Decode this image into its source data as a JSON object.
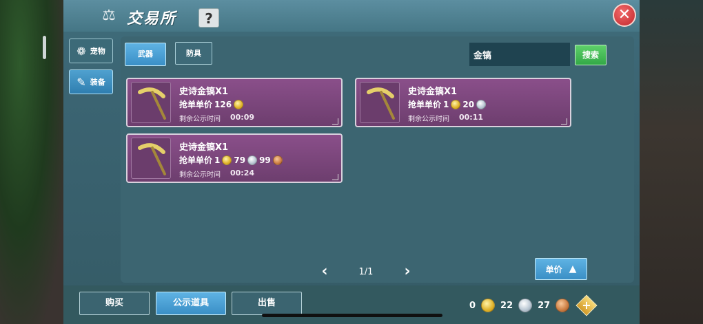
{
  "window": {
    "title": "交易所",
    "help_label": "?",
    "close_label": "✕"
  },
  "sidebar": {
    "items": [
      {
        "label": "宠物",
        "icon": "paw-icon"
      },
      {
        "label": "装备",
        "icon": "equip-icon"
      }
    ]
  },
  "tabs": [
    {
      "label": "武器",
      "active": true
    },
    {
      "label": "防具",
      "active": false
    }
  ],
  "search": {
    "value": "金镐",
    "button_label": "搜索"
  },
  "listings": [
    {
      "name": "史诗金镐X1",
      "price_label": "抢单单价",
      "price": [
        {
          "amount": "126",
          "coin": "gold"
        }
      ],
      "time_label": "剩余公示时间",
      "time": "00:09"
    },
    {
      "name": "史诗金镐X1",
      "price_label": "抢单单价",
      "price": [
        {
          "amount": "1",
          "coin": "gold"
        },
        {
          "amount": "20",
          "coin": "silver"
        }
      ],
      "time_label": "剩余公示时间",
      "time": "00:11"
    },
    {
      "name": "史诗金镐X1",
      "price_label": "抢单单价",
      "price": [
        {
          "amount": "1",
          "coin": "gold"
        },
        {
          "amount": "79",
          "coin": "silver"
        },
        {
          "amount": "99",
          "coin": "copper"
        }
      ],
      "time_label": "剩余公示时间",
      "time": "00:24"
    }
  ],
  "pagination": {
    "prev": "‹",
    "next": "›",
    "page": "1/1"
  },
  "sort": {
    "label": "单价",
    "direction_icon": "sort-arrow-icon"
  },
  "bottom": {
    "buy_label": "购买",
    "public_label": "公示道具",
    "sell_label": "出售"
  },
  "wallet": {
    "gold": "0",
    "silver": "22",
    "copper": "27",
    "add_label": "+"
  },
  "colors": {
    "accent": "#3a8fc6",
    "card": "#7a4579",
    "search": "#33a947",
    "close": "#c0262b"
  }
}
